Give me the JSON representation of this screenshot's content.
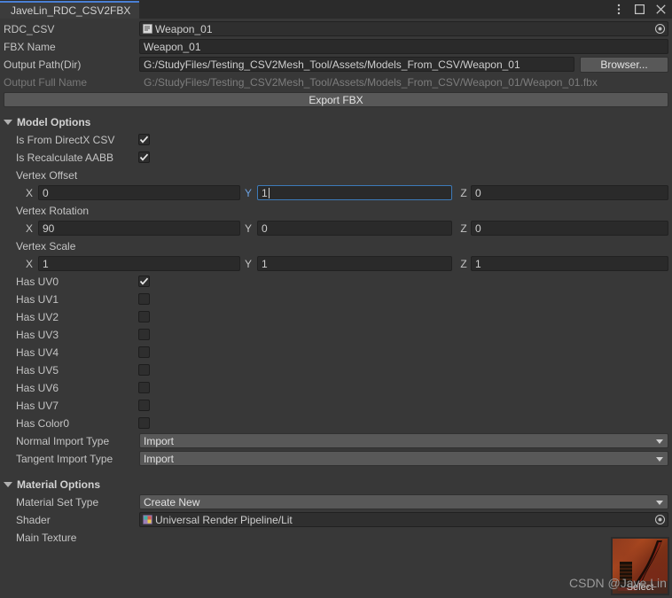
{
  "window": {
    "tab_title": "JaveLin_RDC_CSV2FBX",
    "controls": {
      "menu": "kebab-menu-icon",
      "maximize": "maximize-icon",
      "close": "close-icon"
    },
    "accent_color": "#4a7fd4",
    "background_color": "#383838"
  },
  "header_fields": {
    "rdc_csv": {
      "label": "RDC_CSV",
      "value": "Weapon_01",
      "icon": "text-asset-icon"
    },
    "fbx_name": {
      "label": "FBX Name",
      "value": "Weapon_01"
    },
    "output_path": {
      "label": "Output Path(Dir)",
      "value": "G:/StudyFiles/Testing_CSV2Mesh_Tool/Assets/Models_From_CSV/Weapon_01",
      "button": "Browser..."
    },
    "output_full_name": {
      "label": "Output Full Name",
      "value": "G:/StudyFiles/Testing_CSV2Mesh_Tool/Assets/Models_From_CSV/Weapon_01/Weapon_01.fbx"
    },
    "export_button": "Export FBX"
  },
  "model_options": {
    "title": "Model Options",
    "expanded": true,
    "toggles": [
      {
        "label": "Is From DirectX CSV",
        "checked": true
      },
      {
        "label": "Is Recalculate AABB",
        "checked": true
      }
    ],
    "vectors": [
      {
        "label": "Vertex Offset",
        "x": "0",
        "y": "1",
        "z": "0",
        "focused_axis": "Y"
      },
      {
        "label": "Vertex Rotation",
        "x": "90",
        "y": "0",
        "z": "0",
        "focused_axis": ""
      },
      {
        "label": "Vertex Scale",
        "x": "1",
        "y": "1",
        "z": "1",
        "focused_axis": ""
      }
    ],
    "axis_labels": {
      "x": "X",
      "y": "Y",
      "z": "Z"
    },
    "uv_toggles": [
      {
        "label": "Has UV0",
        "checked": true
      },
      {
        "label": "Has UV1",
        "checked": false
      },
      {
        "label": "Has UV2",
        "checked": false
      },
      {
        "label": "Has UV3",
        "checked": false
      },
      {
        "label": "Has UV4",
        "checked": false
      },
      {
        "label": "Has UV5",
        "checked": false
      },
      {
        "label": "Has UV6",
        "checked": false
      },
      {
        "label": "Has UV7",
        "checked": false
      },
      {
        "label": "Has Color0",
        "checked": false
      }
    ],
    "dropdowns": [
      {
        "label": "Normal Import Type",
        "value": "Import"
      },
      {
        "label": "Tangent Import Type",
        "value": "Import"
      }
    ]
  },
  "material_options": {
    "title": "Material Options",
    "expanded": true,
    "material_set_type": {
      "label": "Material Set Type",
      "value": "Create New"
    },
    "shader": {
      "label": "Shader",
      "value": "Universal Render Pipeline/Lit",
      "icon": "shader-icon"
    },
    "main_texture": {
      "label": "Main Texture",
      "select_label": "Select"
    }
  },
  "watermark": {
    "text": "CSDN @Jave.Lin"
  }
}
